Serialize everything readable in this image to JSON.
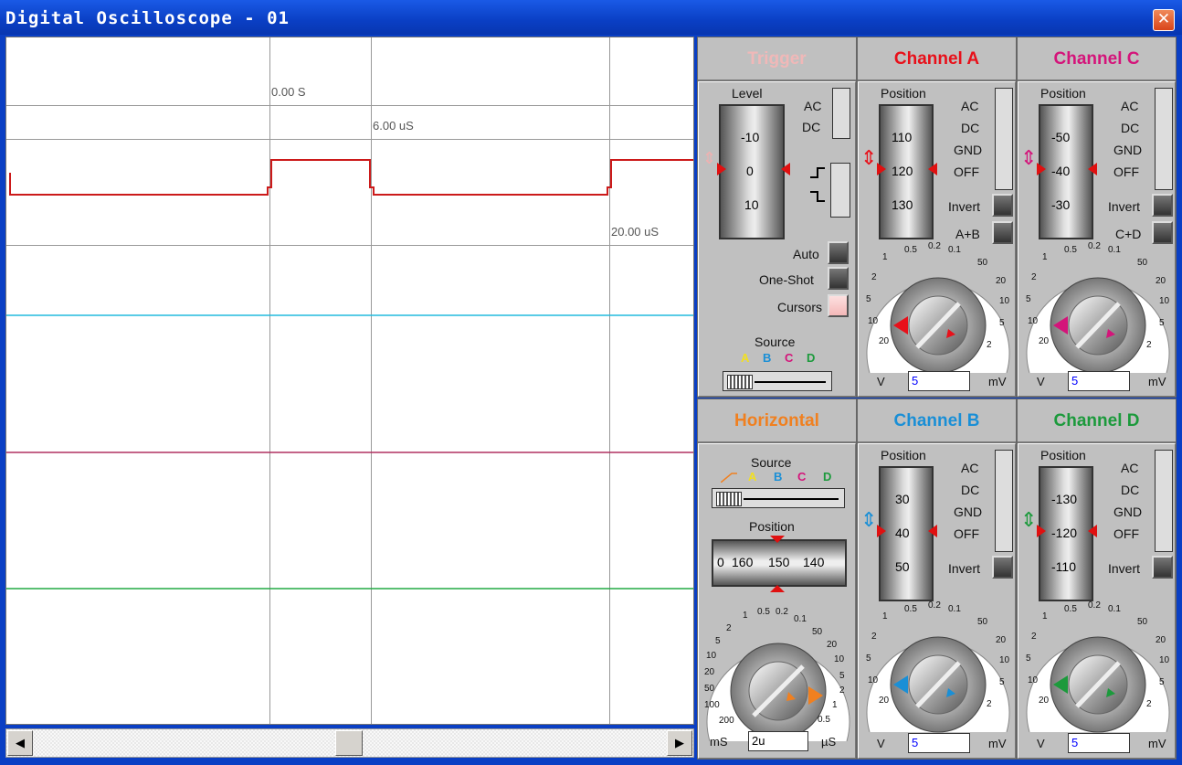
{
  "window": {
    "title": "Digital Oscilloscope - 01",
    "close_glyph": "✕"
  },
  "screen": {
    "time_labels": [
      "0.00 S",
      "6.00 uS",
      "20.00 uS"
    ],
    "trace_colors": {
      "a": "#cc1a1a",
      "b": "#22bbdd",
      "c": "#b03060",
      "d": "#22aa44"
    }
  },
  "trigger": {
    "title": "Trigger",
    "level_label": "Level",
    "ac": "AC",
    "dc": "DC",
    "drum_values": [
      "-10",
      "0",
      "10"
    ],
    "auto": "Auto",
    "one_shot": "One-Shot",
    "cursors": "Cursors",
    "source_label": "Source",
    "sources": [
      "A",
      "B",
      "C",
      "D"
    ]
  },
  "horizontal": {
    "title": "Horizontal",
    "source_label": "Source",
    "sources": [
      "A",
      "B",
      "C",
      "D"
    ],
    "position_label": "Position",
    "tape_values": [
      "0",
      "160",
      "150",
      "140"
    ],
    "dial_left": [
      "1",
      "2",
      "5",
      "10",
      "20",
      "50",
      "100",
      "200"
    ],
    "dial_right": [
      "0.5",
      "0.2",
      "0.1",
      "50",
      "20",
      "10",
      "5",
      "2",
      "1",
      "0.5"
    ],
    "unit_left": "mS",
    "unit_right": "µS",
    "value": "2u"
  },
  "channels": {
    "a": {
      "title": "Channel A",
      "color": "#e8101a",
      "position_label": "Position",
      "drum": [
        "110",
        "120",
        "130"
      ],
      "coupling": [
        "AC",
        "DC",
        "GND",
        "OFF"
      ],
      "invert": "Invert",
      "extra": "A+B",
      "value": "5",
      "unit_left": "V",
      "unit_right": "mV"
    },
    "b": {
      "title": "Channel B",
      "color": "#1a8fd6",
      "position_label": "Position",
      "drum": [
        "30",
        "40",
        "50"
      ],
      "coupling": [
        "AC",
        "DC",
        "GND",
        "OFF"
      ],
      "invert": "Invert",
      "value": "5",
      "unit_left": "V",
      "unit_right": "mV"
    },
    "c": {
      "title": "Channel C",
      "color": "#d4147a",
      "position_label": "Position",
      "drum": [
        "-50",
        "-40",
        "-30"
      ],
      "coupling": [
        "AC",
        "DC",
        "GND",
        "OFF"
      ],
      "invert": "Invert",
      "extra": "C+D",
      "value": "5",
      "unit_left": "V",
      "unit_right": "mV"
    },
    "d": {
      "title": "Channel D",
      "color": "#1c9a3c",
      "position_label": "Position",
      "drum": [
        "-130",
        "-120",
        "-110"
      ],
      "coupling": [
        "AC",
        "DC",
        "GND",
        "OFF"
      ],
      "invert": "Invert",
      "value": "5",
      "unit_left": "V",
      "unit_right": "mV"
    }
  },
  "volt_dial": {
    "left": [
      "1",
      "2",
      "5",
      "10",
      "20"
    ],
    "top": [
      "0.5",
      "0.2",
      "0.1"
    ],
    "right": [
      "50",
      "20",
      "10",
      "5",
      "2"
    ]
  },
  "scroll": {
    "left_glyph": "◀",
    "right_glyph": "▶"
  }
}
